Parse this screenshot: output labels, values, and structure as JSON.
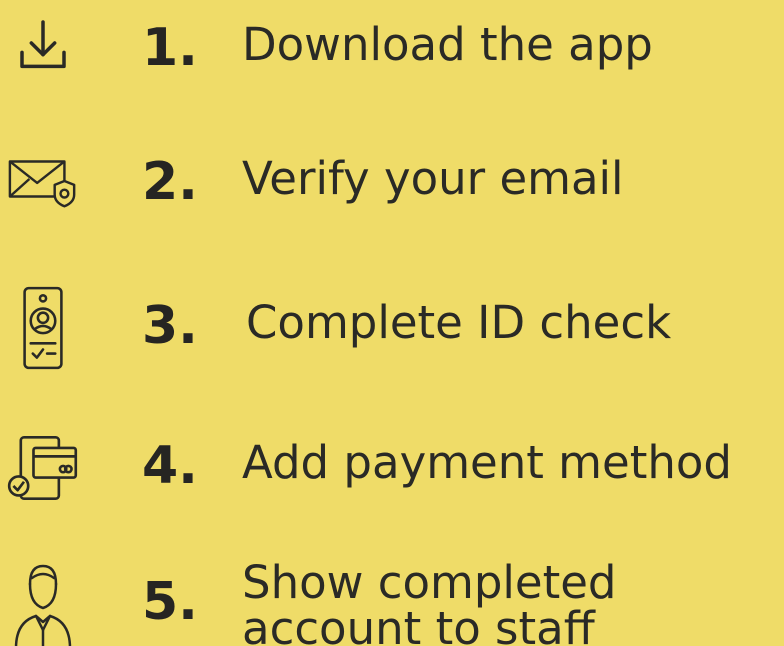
{
  "steps": [
    {
      "number": "1.",
      "label": "Download the app",
      "icon": "download-icon"
    },
    {
      "number": "2.",
      "label": "Verify your email",
      "icon": "email-shield-icon"
    },
    {
      "number": "3.",
      "label": "Complete ID check",
      "icon": "id-check-phone-icon"
    },
    {
      "number": "4.",
      "label": "Add payment method",
      "icon": "payment-card-icon"
    },
    {
      "number": "5.",
      "label": "Show completed account to staff",
      "icon": "staff-person-icon"
    }
  ],
  "colors": {
    "background": "#efdc68",
    "text": "#2a2a26",
    "number": "#262522"
  }
}
